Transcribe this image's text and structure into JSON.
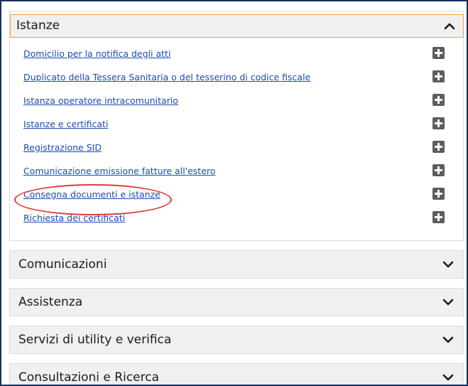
{
  "open_section": {
    "title": "Istanze",
    "toggle_icon": "chevron-up-icon",
    "items": [
      {
        "label": "Domicilio per la notifica degli atti",
        "action_icon": "plus-icon"
      },
      {
        "label": "Duplicato della Tessera Sanitaria o del tesserino di codice fiscale",
        "action_icon": "plus-icon"
      },
      {
        "label": "Istanza operatore intracomunitario",
        "action_icon": "plus-icon"
      },
      {
        "label": "Istanze e certificati",
        "action_icon": "plus-icon"
      },
      {
        "label": "Registrazione SID",
        "action_icon": "plus-icon"
      },
      {
        "label": "Comunicazione emissione fatture all'estero",
        "action_icon": "plus-icon"
      },
      {
        "label": "Consegna documenti e istanze",
        "action_icon": "plus-icon",
        "highlighted": true
      },
      {
        "label": "Richiesta dei certificati",
        "action_icon": "plus-icon"
      }
    ]
  },
  "collapsed_sections": [
    {
      "title": "Comunicazioni",
      "toggle_icon": "chevron-down-icon"
    },
    {
      "title": "Assistenza",
      "toggle_icon": "chevron-down-icon"
    },
    {
      "title": "Servizi di utility e verifica",
      "toggle_icon": "chevron-down-icon"
    },
    {
      "title": "Consultazioni e Ricerca",
      "toggle_icon": "chevron-down-icon"
    }
  ],
  "colors": {
    "link": "#1a4bb5",
    "header_border_active": "#f0a33a",
    "highlight": "#e23a3a",
    "frame_border": "#15305f",
    "icon_button": "#5d5d5d"
  }
}
